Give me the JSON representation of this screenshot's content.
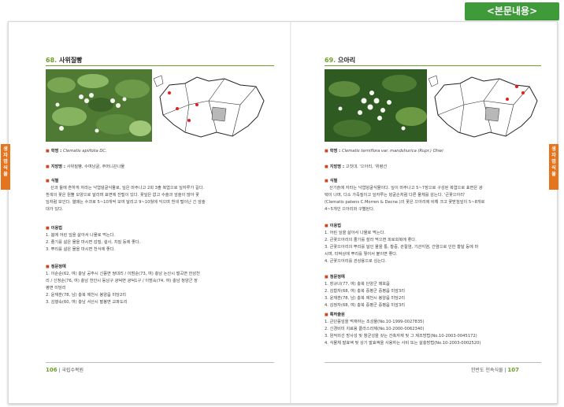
{
  "top_tag": "<본문내용>",
  "side_tab_label": "생 자 엽 식 물",
  "left": {
    "number": "68.",
    "name": "사위질빵",
    "scientific_label": "학명 : ",
    "scientific_name": "Clematis apiifolia DC.",
    "local_label": "지방명 : ",
    "local_name": "사위질빵, 수여남굴, 주머니끈나물",
    "id_head": "식별",
    "id_text": [
      "산과 들에 흔하게 자라는 낙엽덩굴식물로, 잎은 마주나고 2회 3출 복엽으로 잎자루가 길다.",
      "흰색의 꽃은 원뿔 모양으로 달리며 표면에 잔털이 있다. 꽃잎은 없고 수술과 암술이 많아 꽃",
      "잎처럼 보인다. 열매는 수과로 5~10개씩 모여 달리고 9~10월에 익으며 흰색 털이난 긴 암술",
      "대가 있다."
    ],
    "use_head": "이용법",
    "use_text": [
      "1. 봄에 어린 잎을 삶아서 나물로 먹는다.",
      "2. 줄기를 삶은 물을 마시면 감질, 설사, 치질 등에 좋다.",
      "3. 뿌리를 삶은 물을 마시면 천식에 좋다."
    ],
    "inf_head": "정문정예",
    "inf_text": [
      "1. 이순순(62, 여) 충남 공주시 신풍면 쌍대리 / 이범순(73, 여) 충남 논산시 벌곡면 한삼천",
      "   리 / 신청순(76, 여) 충남 천안시 동남구 광덕면 광덕1구 / 이범숙(74, 여) 충남 청양군 장",
      "   평면 미당리",
      "2. 윤재훈(78, 남) 충북 제천시 봉양읍 미당2리",
      "3. 김행숙(60, 여) 충남 서산시 팔봉면 교파도리"
    ],
    "folio_num": "106",
    "folio_text": "국립수목원"
  },
  "right": {
    "number": "69.",
    "name": "으아리",
    "scientific_label": "학명 : ",
    "scientific_name": "Clematis terniflora var. mandshurica (Rupr.) Ohwi",
    "local_label": "지방명 : ",
    "local_name": "고칫대, '으아리, '위령선",
    "id_head": "식별",
    "id_text": [
      "산기슭에 자라는 낙엽덩굴식물이다. 잎이 마주나고 5~7장으로 구성된 복엽으로 표면은 광",
      "택이 나며, 다소 가죽질이고 잎자루는 덩굴손처럼 다른 물체를 감는다. '큰꽃으아리'",
      "(Clematis patens C.Morren & Decne.)의 꽃은 으아리에 비해 크고 꽃받침잎이 5~8개로",
      "4~5개인 으아리와 구별된다."
    ],
    "use_head": "이용법",
    "use_text": [
      "1. 어린 잎을 삶아서 나물로 먹는다.",
      "2. 큰꽃으아리의 줄기를 잘라 먹으면 피로회복에 좋다.",
      "3. 큰꽃으아리의 뿌리를 달인 물을 통, 황증, 관절염, 기관지염, 간염으로 인한 황달 등에 마",
      "   시며, 타박상에 뿌리를 찧어서 붙이면 좋다.",
      "4. 큰꽃으아리를 관상용으로 심는다."
    ],
    "inf_head": "정문정예",
    "inf_text": [
      "1. 장규녀(77, 여) 충북 단양군 매포읍",
      "2. 김합자(68, 여) 충북 증평군 증평읍 미암3리",
      "3. 윤재훈(78, 남) 충북 제천시 봉양읍 미당2리",
      "4. 김정자(68, 여) 충북 증평군 증평읍 미암3리"
    ],
    "pat_head": "특허출원",
    "pat_text": [
      "1. 큰단풍잎을 먹재하는 조성물(No.10-1999-0027835)",
      "2. 신경비미 치료용 클라스라제(No.10-2000-0062340)",
      "3. 원적외선 방사성 및 항균성을 갖는 건축자재 및 그 제조방법(No.10-2003-0045172)",
      "4. 식물체 발효액 및 상기 발효액을 사용하는 사비 또는 살충방법(No.10-2003-0002520)"
    ],
    "folio_num": "107",
    "folio_text": "한반도 민속식물"
  },
  "colors": {
    "accent": "#6f9f2a",
    "tab": "#e4751e",
    "tag": "#3f9a3a",
    "bullet": "#c9481f"
  }
}
